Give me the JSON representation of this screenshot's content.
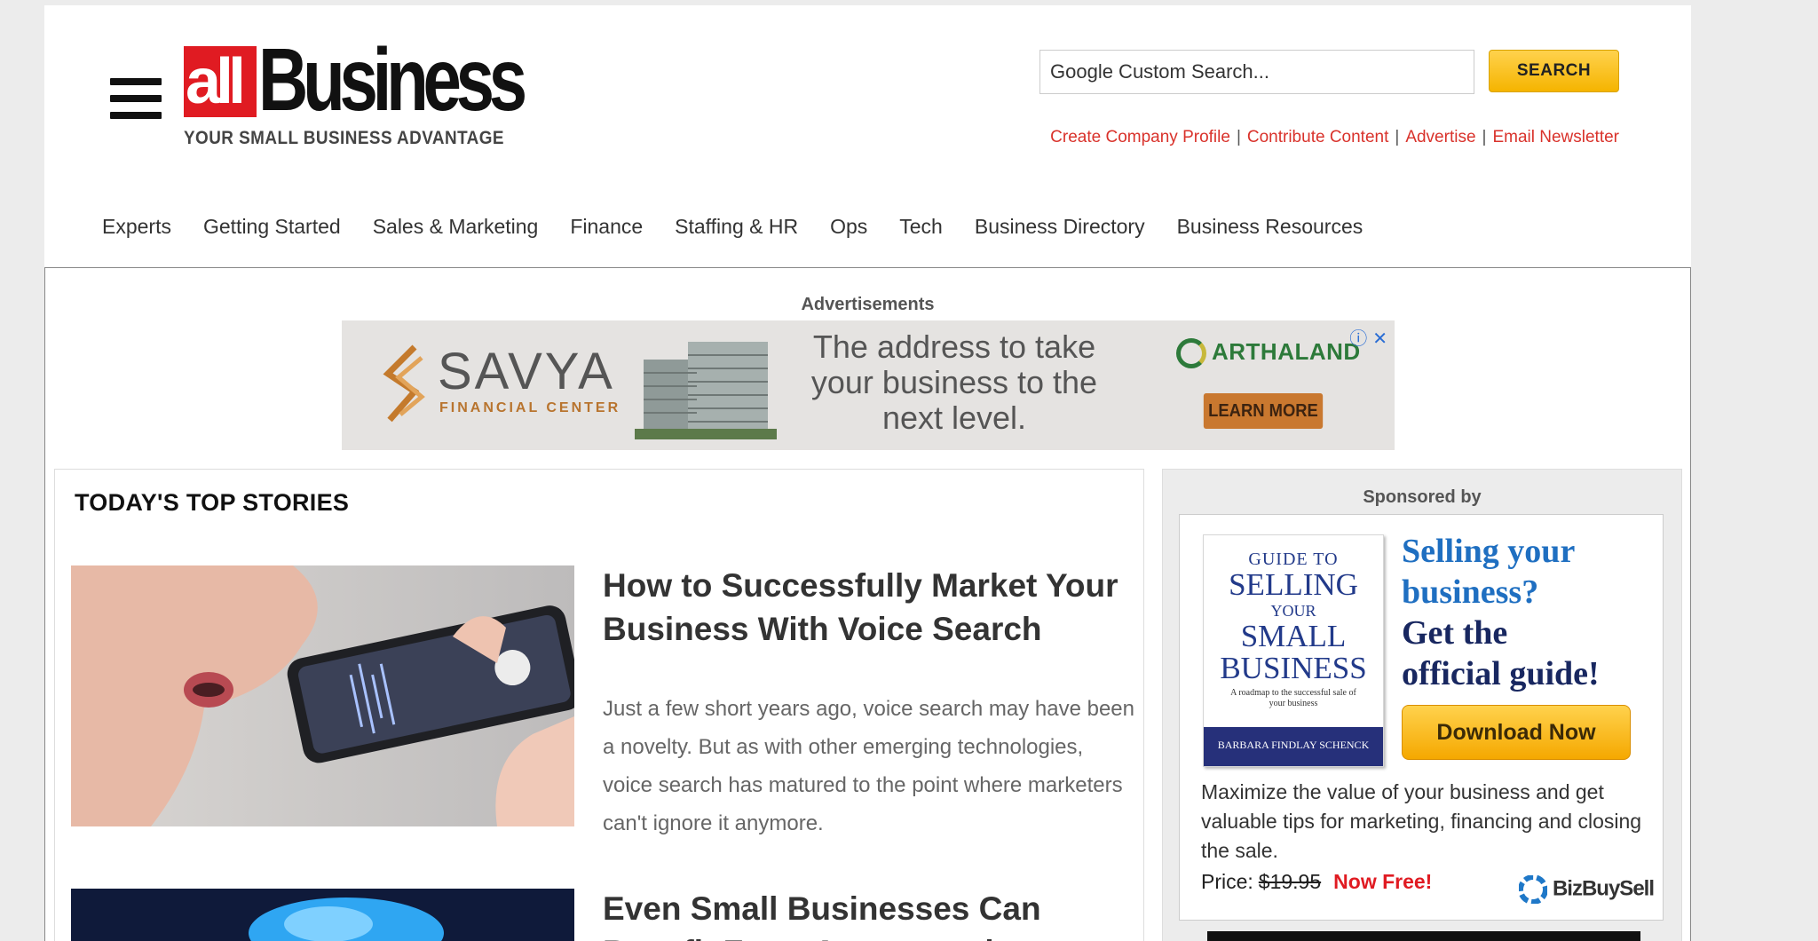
{
  "header": {
    "logo": {
      "red_text": "all",
      "black_text": "Business",
      "tagline": "YOUR SMALL BUSINESS ADVANTAGE"
    },
    "search": {
      "placeholder": "Google Custom Search...",
      "button_label": "SEARCH"
    },
    "util_links": [
      "Create Company Profile",
      "Contribute Content",
      "Advertise",
      "Email Newsletter"
    ],
    "nav": [
      "Experts",
      "Getting Started",
      "Sales & Marketing",
      "Finance",
      "Staffing & HR",
      "Ops",
      "Tech",
      "Business Directory",
      "Business Resources"
    ]
  },
  "ads": {
    "label": "Advertisements",
    "banner": {
      "brand": "SAVYA",
      "brand_sub": "FINANCIAL CENTER",
      "tagline": "The address to take your business to the next level.",
      "partner": "ARTHALAND",
      "cta": "LEARN MORE",
      "info_icon": "ⓘ",
      "close_icon": "✕"
    }
  },
  "top_stories": {
    "title": "TODAY'S TOP STORIES",
    "stories": [
      {
        "title": "How to Successfully Market Your Business With Voice Search",
        "description": "Just a few short years ago, voice search may have been a novelty. But as with other emerging technologies, voice search has matured to the point where marketers can't ignore it anymore."
      },
      {
        "title": "Even Small Businesses Can Benefit From Augmented",
        "description": ""
      }
    ]
  },
  "sponsored": {
    "label": "Sponsored by",
    "book": {
      "guide_to": "GUIDE TO",
      "title_line1": "SELLING",
      "title_line2": "YOUR",
      "title_line3": "SMALL",
      "title_line4": "BUSINESS",
      "subtitle": "A roadmap to the successful sale of your business",
      "author": "BARBARA FINDLAY SCHENCK"
    },
    "headline_line1": "Selling your",
    "headline_line2": "business?",
    "headline_line3": "Get the",
    "headline_line4": "official guide!",
    "download_button": "Download Now",
    "description": "Maximize the value of your business and get valuable tips for marketing, financing and closing the sale.",
    "price_label": "Price:",
    "old_price": "$19.95",
    "free_label": "Now Free!",
    "brand": "BizBuySell"
  }
}
